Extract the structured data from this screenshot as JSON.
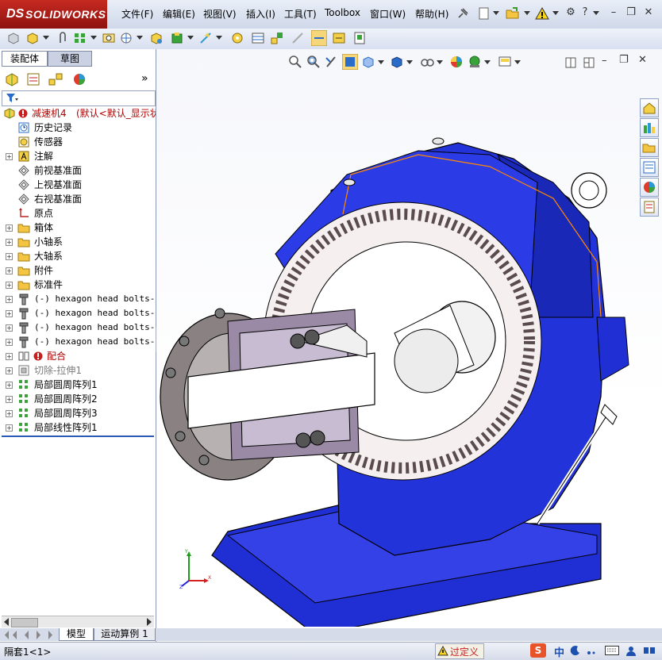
{
  "app": {
    "brand_ds": "DS",
    "brand_name": "SOLIDWORKS"
  },
  "menu": {
    "items": [
      {
        "label": "文件(F)"
      },
      {
        "label": "编辑(E)"
      },
      {
        "label": "视图(V)"
      },
      {
        "label": "插入(I)"
      },
      {
        "label": "工具(T)"
      },
      {
        "label": "Toolbox"
      },
      {
        "label": "窗口(W)"
      },
      {
        "label": "帮助(H)"
      }
    ]
  },
  "panel": {
    "tabs": [
      {
        "label": "装配体"
      },
      {
        "label": "草图"
      }
    ],
    "more": "»",
    "filter_icon": "filter-icon"
  },
  "tree": {
    "root_name": "减速机4",
    "root_config": "(默认<默认_显示状",
    "items": [
      {
        "label": "历史记录",
        "icon": "history-icon"
      },
      {
        "label": "传感器",
        "icon": "sensor-icon"
      },
      {
        "label": "注解",
        "icon": "annotation-icon",
        "expand": "+"
      },
      {
        "label": "前视基准面",
        "icon": "plane-icon"
      },
      {
        "label": "上视基准面",
        "icon": "plane-icon"
      },
      {
        "label": "右视基准面",
        "icon": "plane-icon"
      },
      {
        "label": "原点",
        "icon": "origin-icon"
      },
      {
        "label": "箱体",
        "icon": "folder-icon",
        "expand": "+"
      },
      {
        "label": "小轴系",
        "icon": "folder-icon",
        "expand": "+"
      },
      {
        "label": "大轴系",
        "icon": "folder-icon",
        "expand": "+"
      },
      {
        "label": "附件",
        "icon": "folder-icon",
        "expand": "+"
      },
      {
        "label": "标准件",
        "icon": "folder-icon",
        "expand": "+"
      },
      {
        "label": "(-) hexagon head bolts-fu",
        "icon": "bolt-icon",
        "expand": "+",
        "mono": true
      },
      {
        "label": "(-) hexagon head bolts-fu",
        "icon": "bolt-icon",
        "expand": "+",
        "mono": true
      },
      {
        "label": "(-) hexagon head bolts-fu",
        "icon": "bolt-icon",
        "expand": "+",
        "mono": true
      },
      {
        "label": "(-) hexagon head bolts-fu",
        "icon": "bolt-icon",
        "expand": "+",
        "mono": true
      },
      {
        "label": "配合",
        "icon": "mate-icon",
        "expand": "+",
        "color": "#b00000",
        "error": true
      },
      {
        "label": "切除-拉伸1",
        "icon": "cut-extrude-icon",
        "expand": "+",
        "color": "#7a7a7a"
      },
      {
        "label": "局部圆周阵列1",
        "icon": "pattern-icon",
        "expand": "+"
      },
      {
        "label": "局部圆周阵列2",
        "icon": "pattern-icon",
        "expand": "+"
      },
      {
        "label": "局部圆周阵列3",
        "icon": "pattern-icon",
        "expand": "+"
      },
      {
        "label": "局部线性阵列1",
        "icon": "pattern-icon",
        "expand": "+"
      }
    ]
  },
  "bottom_tabs": [
    {
      "label": "模型"
    },
    {
      "label": "运动算例 1"
    }
  ],
  "status": {
    "left": "隔套1<1>",
    "rebuild": "过定义",
    "ime_logo": "S",
    "ime_lang": "中"
  },
  "colors": {
    "accent_blue": "#2332d8",
    "error_red": "#c81e1e"
  }
}
